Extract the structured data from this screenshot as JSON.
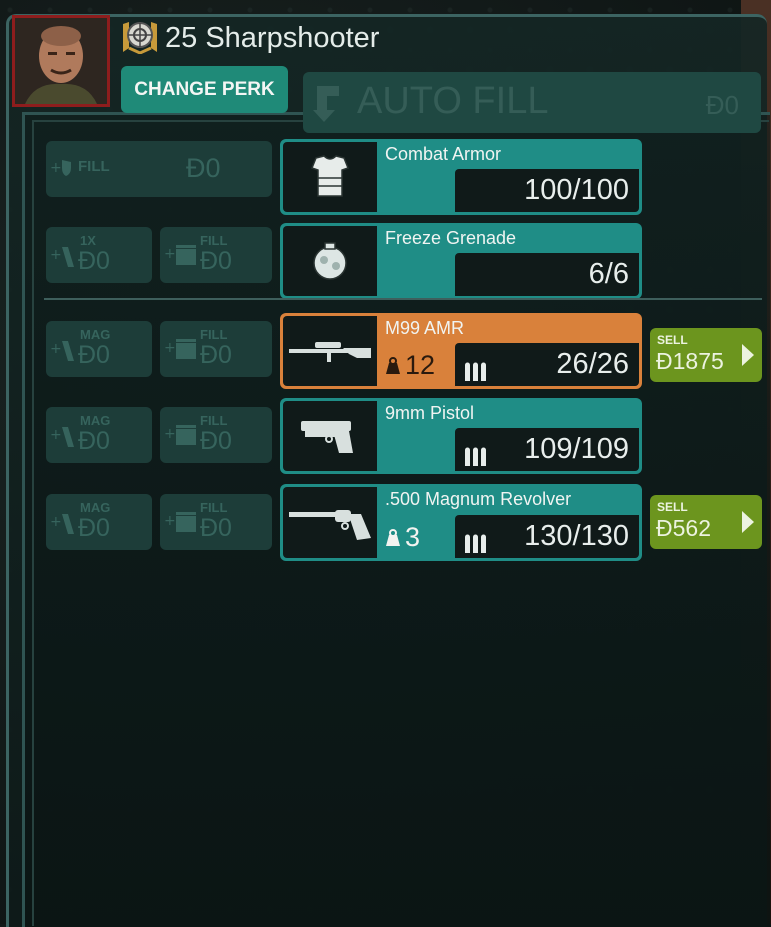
{
  "header": {
    "level": "25",
    "perk_name": "Sharpshooter",
    "title": "25 Sharpshooter",
    "change_perk_label": "CHANGE PERK",
    "autofill_label": "AUTO FILL",
    "autofill_cost": "Ð0"
  },
  "armor_row": {
    "fill_label": "FILL",
    "fill_cost": "Ð0",
    "item_name": "Combat Armor",
    "value": "100/100"
  },
  "grenade_row": {
    "one_label": "1X",
    "one_cost": "Ð0",
    "fill_label": "FILL",
    "fill_cost": "Ð0",
    "item_name": "Freeze Grenade",
    "value": "6/6"
  },
  "weapons": [
    {
      "mag_label": "MAG",
      "mag_cost": "Ð0",
      "fill_label": "FILL",
      "fill_cost": "Ð0",
      "name": "M99 AMR",
      "weight": "12",
      "ammo": "26/26",
      "sell_label": "SELL",
      "sell_price": "Ð1875"
    },
    {
      "mag_label": "MAG",
      "mag_cost": "Ð0",
      "fill_label": "FILL",
      "fill_cost": "Ð0",
      "name": "9mm Pistol",
      "ammo": "109/109"
    },
    {
      "mag_label": "MAG",
      "mag_cost": "Ð0",
      "fill_label": "FILL",
      "fill_cost": "Ð0",
      "name": ".500 Magnum Revolver",
      "weight": "3",
      "ammo": "130/130",
      "sell_label": "SELL",
      "sell_price": "Ð562"
    }
  ],
  "colors": {
    "accent_teal": "#1f8d86",
    "selected_orange": "#d9813b",
    "sell_green": "#6c951e",
    "perk_button": "#1f8a78"
  },
  "icons": [
    "perk-sharpshooter-icon",
    "autofill-arrow-icon",
    "armor-shield-icon",
    "magazine-icon",
    "ammo-box-icon",
    "weight-icon",
    "bullets-icon",
    "sell-arrow-icon"
  ]
}
